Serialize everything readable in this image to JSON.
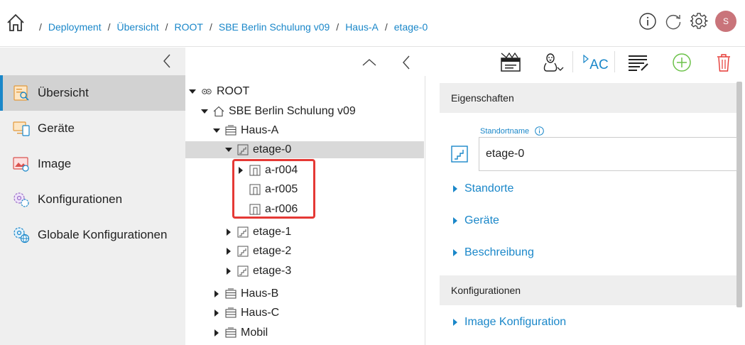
{
  "breadcrumb": {
    "separator": "/",
    "items": [
      "Deployment",
      "Übersicht",
      "ROOT",
      "SBE Berlin Schulung v09",
      "Haus-A",
      "etage-0"
    ]
  },
  "header": {
    "user_initial": "S",
    "icons": [
      "home-icon",
      "info-icon",
      "refresh-icon",
      "gear-icon"
    ]
  },
  "sidebar": {
    "items": [
      {
        "label": "Übersicht",
        "icon": "overview-icon",
        "active": true
      },
      {
        "label": "Geräte",
        "icon": "devices-icon"
      },
      {
        "label": "Image",
        "icon": "image-icon"
      },
      {
        "label": "Konfigurationen",
        "icon": "config-icon"
      },
      {
        "label": "Globale Konfigurationen",
        "icon": "global-config-icon"
      }
    ]
  },
  "toolbar": {
    "add_button_label": "AC",
    "icons": [
      "chevron-up-icon",
      "chevron-left-icon",
      "clapper-icon",
      "linux-icon",
      "rename-icon",
      "list-edit-icon",
      "add-icon",
      "delete-icon"
    ]
  },
  "tree": {
    "nodes": [
      {
        "label": "ROOT",
        "icon": "root-icon",
        "expanded": true
      },
      {
        "label": "SBE Berlin Schulung v09",
        "icon": "home-icon",
        "expanded": true
      },
      {
        "label": "Haus-A",
        "icon": "building-icon",
        "expanded": true
      },
      {
        "label": "etage-0",
        "icon": "floor-icon",
        "expanded": true,
        "selected": true
      },
      {
        "label": "a-r004",
        "icon": "room-icon",
        "expanded": false
      },
      {
        "label": "a-r005",
        "icon": "room-icon",
        "leaf": true
      },
      {
        "label": "a-r006",
        "icon": "room-icon",
        "leaf": true
      },
      {
        "label": "etage-1",
        "icon": "floor-icon",
        "expanded": false
      },
      {
        "label": "etage-2",
        "icon": "floor-icon",
        "expanded": false
      },
      {
        "label": "etage-3",
        "icon": "floor-icon",
        "expanded": false
      },
      {
        "label": "Haus-B",
        "icon": "building-icon",
        "expanded": false
      },
      {
        "label": "Haus-C",
        "icon": "building-icon",
        "expanded": false
      },
      {
        "label": "Mobil",
        "icon": "building-icon",
        "expanded": false
      }
    ]
  },
  "detail": {
    "properties_title": "Eigenschaften",
    "location_name_label": "Standortname",
    "location_name_value": "etage-0",
    "sections": [
      "Standorte",
      "Geräte",
      "Beschreibung"
    ],
    "config_title": "Konfigurationen",
    "config_sections": [
      "Image Konfiguration"
    ]
  },
  "colors": {
    "accent": "#1a87c9",
    "highlight": "#e53935",
    "add": "#6cc24a",
    "delete": "#e53935"
  }
}
